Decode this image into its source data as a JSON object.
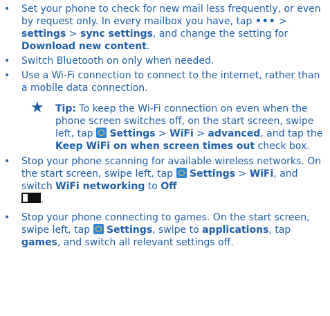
{
  "bullet_char": "•",
  "tip_icon": "star-icon",
  "accent_color": "#1d5fa8",
  "items": [
    {
      "p1": "Set your phone to check for new mail less frequently, or even by request only. In every mailbox you have, tap ",
      "p2": " > ",
      "b1": "settings",
      "p3": " > ",
      "b2": "sync settings",
      "p4": ", and change the setting for ",
      "b3": "Download new content",
      "p5": "."
    },
    {
      "text": "Switch Bluetooth on only when needed."
    },
    {
      "text": "Use a Wi-Fi connection to connect to the internet, rather than a mobile data connection."
    },
    {
      "p1": "Stop your phone scanning for available wireless networks. On the start screen, swipe left, tap ",
      "b1": "Settings",
      "p2": " > ",
      "b2": "WiFi",
      "p3": ", and switch ",
      "b3": "WiFi networking",
      "p4": " to ",
      "b4": "Off",
      "p5": "."
    },
    {
      "p1": "Stop your phone connecting to games. On the start screen, swipe left, tap ",
      "b1": "Settings",
      "p2": ", swipe to ",
      "b2": "applications",
      "p3": ", tap ",
      "b3": "games",
      "p4": ", and switch all relevant settings off."
    }
  ],
  "more_icon_glyph": "•••",
  "tip": {
    "label": "Tip:",
    "p1": " To keep the Wi-Fi connection on even when the phone screen switches off, on the start screen, swipe left, tap ",
    "b1": "Settings",
    "p2": " > ",
    "b2": "WiFi",
    "p3": " > ",
    "b3": "advanced",
    "p4": ", and tap the ",
    "b4": "Keep WiFi on when screen times out",
    "p5": " check box."
  }
}
